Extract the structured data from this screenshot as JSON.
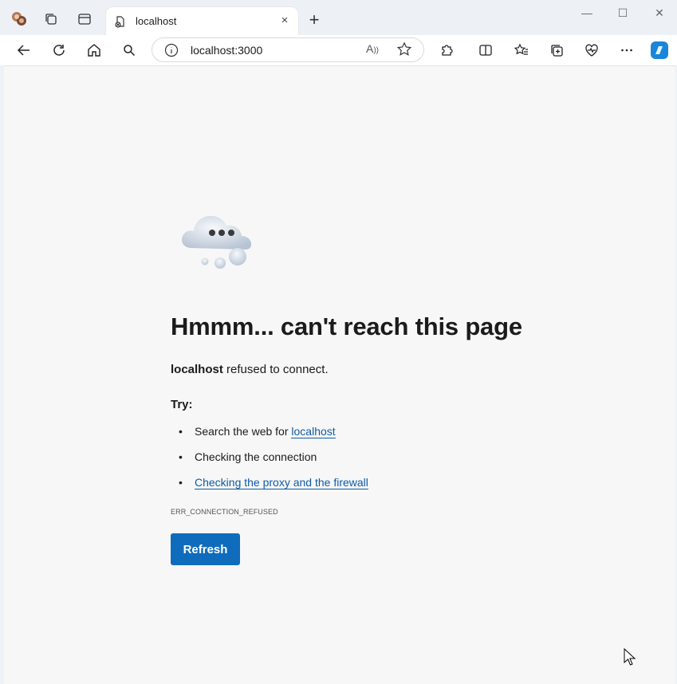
{
  "tab": {
    "title": "localhost",
    "close_glyph": "×"
  },
  "window_controls": {
    "minimize": "—",
    "maximize": "☐",
    "close": "✕"
  },
  "address_bar": {
    "url": "localhost:3000",
    "read_aloud_glyph": "A"
  },
  "new_tab_glyph": "+",
  "error_page": {
    "heading": "Hmmm... can't reach this page",
    "host": "localhost",
    "message": " refused to connect.",
    "try_label": "Try:",
    "suggestions": [
      {
        "prefix": "Search the web for ",
        "link": "localhost"
      },
      {
        "text": "Checking the connection"
      },
      {
        "link": "Checking the proxy and the firewall"
      }
    ],
    "bullet": "•",
    "error_code": "ERR_CONNECTION_REFUSED",
    "refresh_label": "Refresh"
  },
  "colors": {
    "accent": "#0f6cbd",
    "link": "#0f5aa6",
    "page_bg": "#f7f7f7"
  }
}
